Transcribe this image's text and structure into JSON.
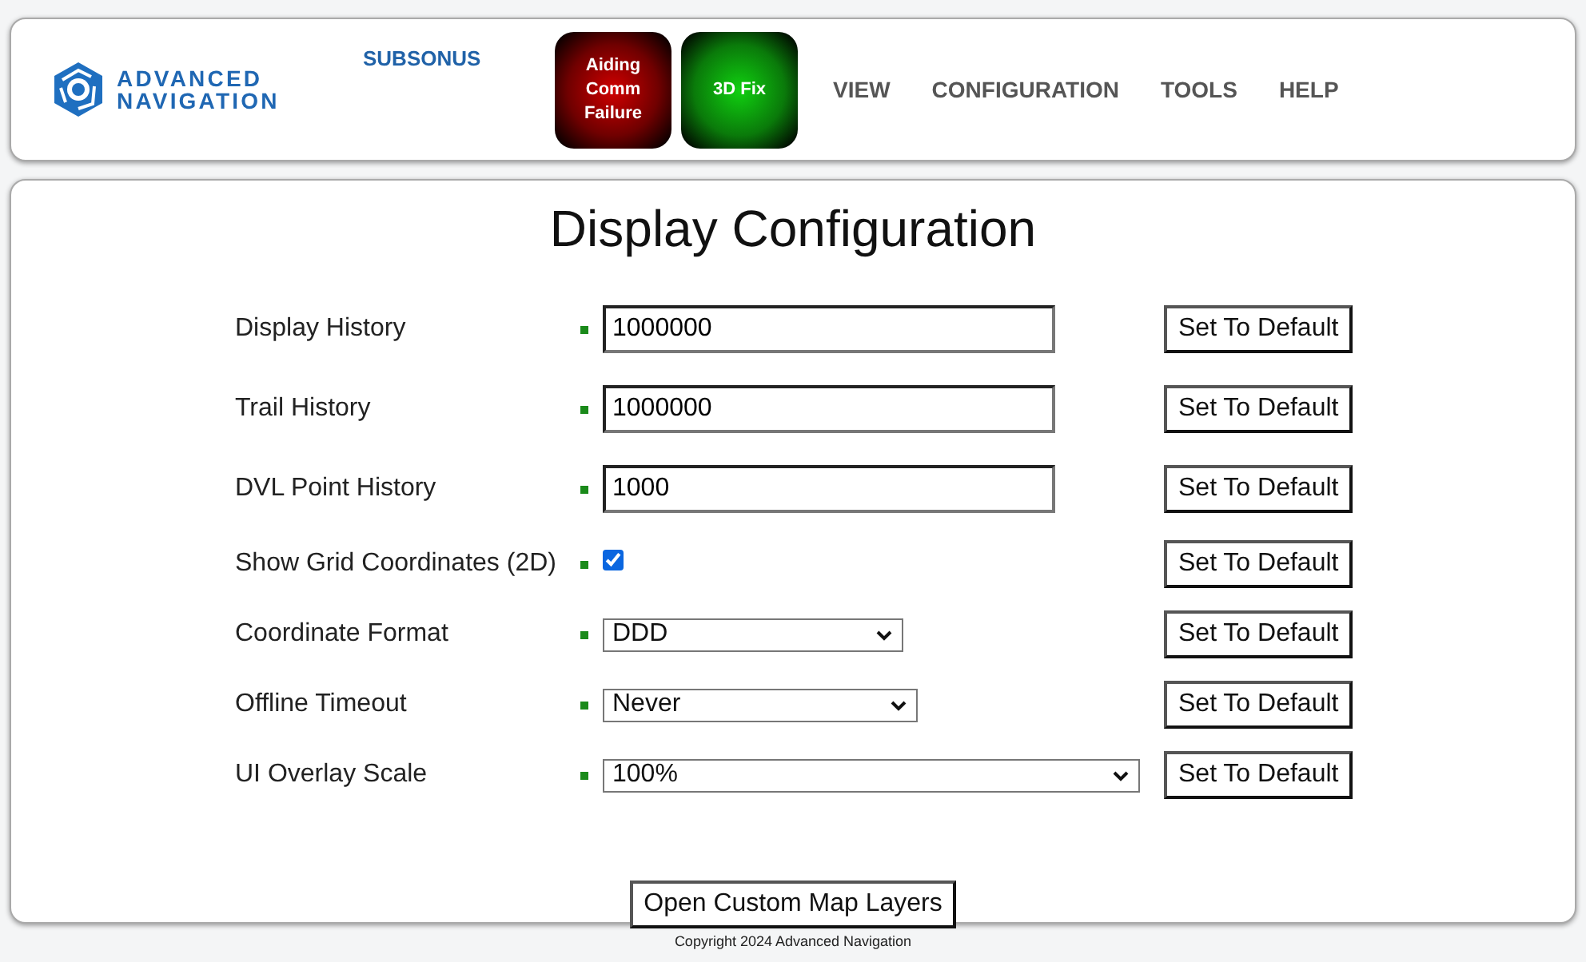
{
  "header": {
    "logo_text": "ADVANCED NAVIGATION",
    "device": "SUBSONUS",
    "indicators": [
      {
        "label": "Aiding Comm Failure",
        "kind": "fault"
      },
      {
        "label": "3D Fix",
        "kind": "ok"
      }
    ],
    "menu": [
      "VIEW",
      "CONFIGURATION",
      "TOOLS",
      "HELP"
    ]
  },
  "page": {
    "title": "Display Configuration",
    "settings": [
      {
        "label": "Display History",
        "kind": "text",
        "value": "1000000",
        "button": "Set To Default"
      },
      {
        "label": "Trail History",
        "kind": "text",
        "value": "1000000",
        "button": "Set To Default"
      },
      {
        "label": "DVL Point History",
        "kind": "text",
        "value": "1000",
        "button": "Set To Default"
      },
      {
        "label": "Show Grid Coordinates (2D)",
        "kind": "checkbox",
        "checked": true,
        "button": "Set To Default"
      },
      {
        "label": "Coordinate Format",
        "kind": "select",
        "value": "DDD",
        "button": "Set To Default"
      },
      {
        "label": "Offline Timeout",
        "kind": "select",
        "value": "Never",
        "button": "Set To Default"
      },
      {
        "label": "UI Overlay Scale",
        "kind": "select",
        "value": "100%",
        "button": "Set To Default"
      }
    ],
    "action": "Open Custom Map Layers"
  },
  "footer": "Copyright 2024 Advanced Navigation"
}
